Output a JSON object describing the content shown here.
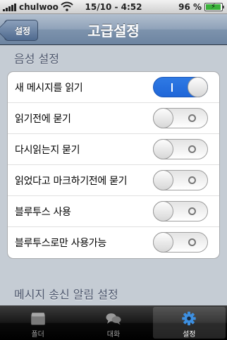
{
  "status_bar": {
    "carrier": "chulwoo",
    "time": "15/10 - 4:52",
    "battery_percent": "96 %",
    "battery_level": 0.96
  },
  "nav": {
    "back_label": "설정",
    "title": "고급설정"
  },
  "sections": [
    {
      "header": "음성 설정"
    },
    {
      "header": "메시지 송신 알림 설정"
    }
  ],
  "settings": [
    {
      "label": "새 메시지를 읽기",
      "on": true,
      "on_glyph": "I"
    },
    {
      "label": "읽기전에 묻기",
      "on": false,
      "off_glyph": "O"
    },
    {
      "label": "다시읽는지 묻기",
      "on": false,
      "off_glyph": "O"
    },
    {
      "label": "읽었다고 마크하기전에 묻기",
      "on": false,
      "off_glyph": "O"
    },
    {
      "label": "블루투스 사용",
      "on": false,
      "off_glyph": "O"
    },
    {
      "label": "블루투스로만 사용가능",
      "on": false,
      "off_glyph": "O"
    }
  ],
  "tabs": [
    {
      "label": "폴더",
      "icon": "folder-icon",
      "active": false
    },
    {
      "label": "대화",
      "icon": "chat-bubbles-icon",
      "active": false
    },
    {
      "label": "설정",
      "icon": "gear-icon",
      "active": true
    }
  ],
  "colors": {
    "toggle_on": "#1f66d8",
    "background": "#c5ccd4",
    "nav_bar": "#6d84a1",
    "section_header": "#4c566c",
    "tab_active_icon": "#3d8fe0"
  }
}
